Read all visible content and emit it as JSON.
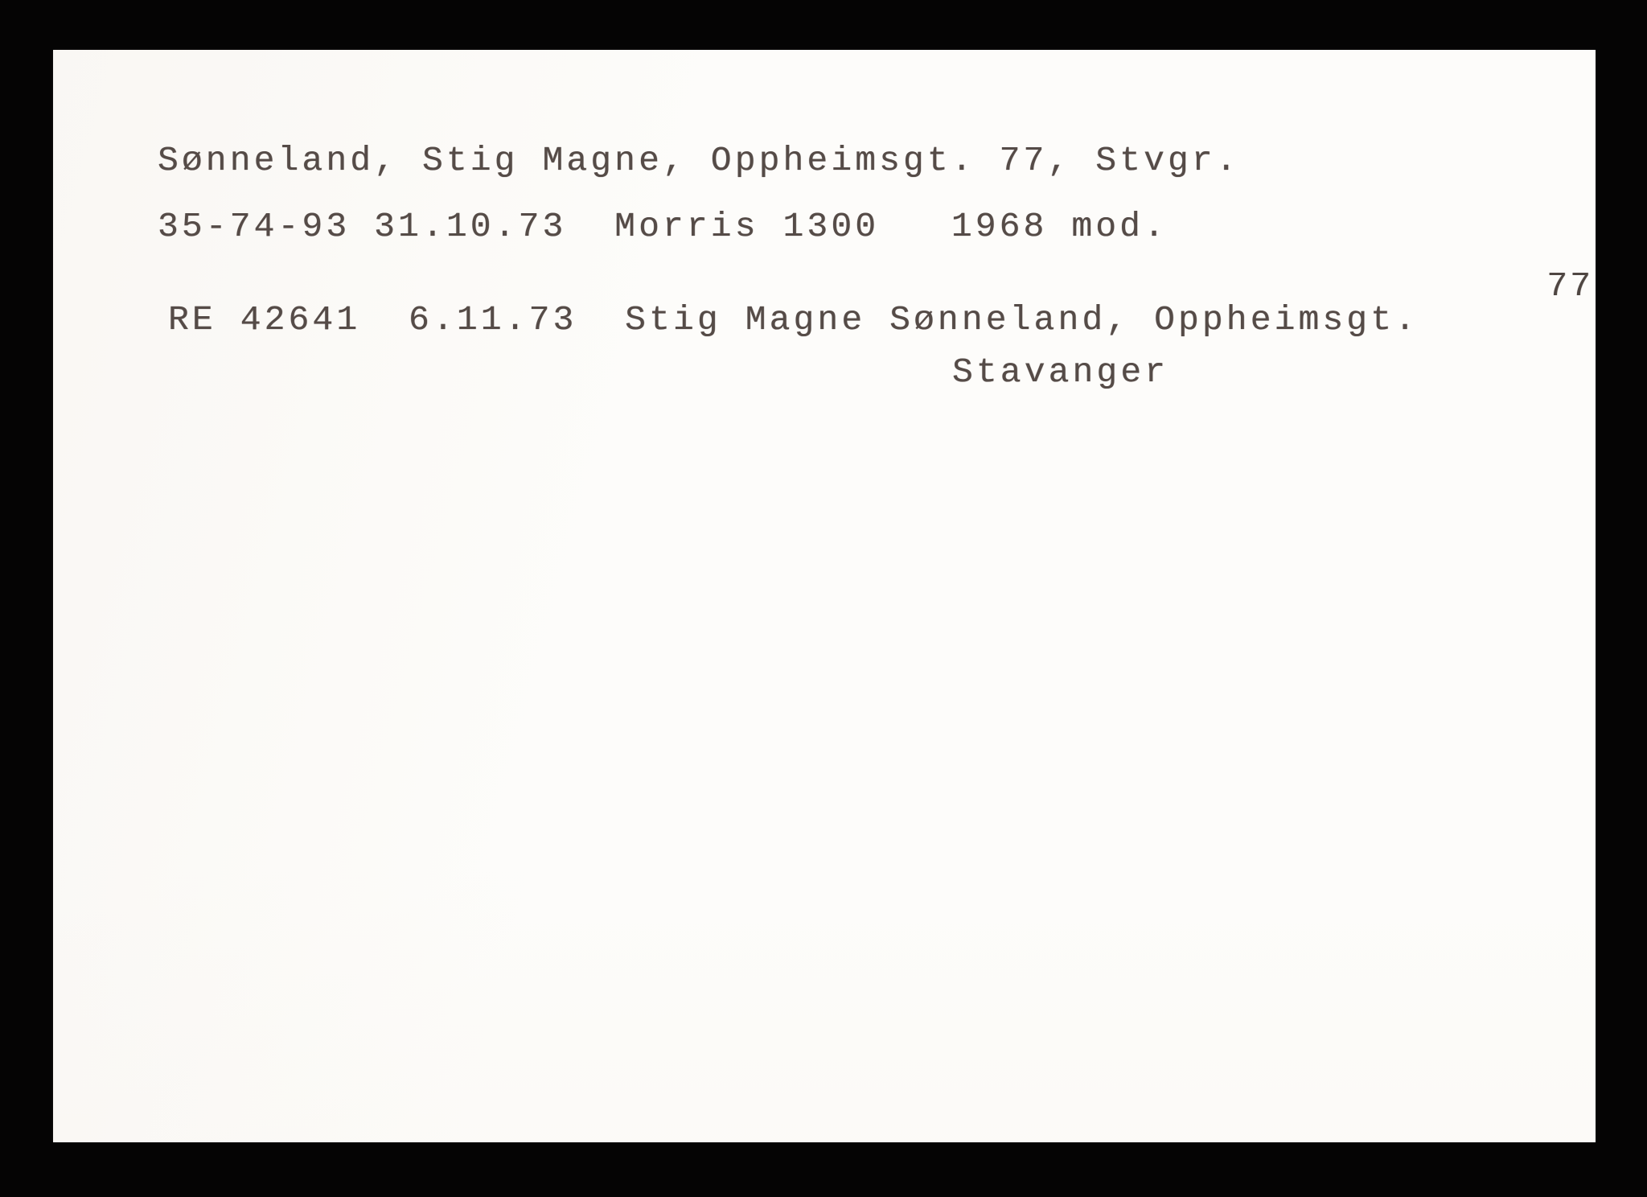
{
  "card": {
    "background_color": "#fdfcfa",
    "backdrop_color": "#050404",
    "ink_color": "#554b47",
    "card_number": "77",
    "lines": {
      "owner": "Sønneland, Stig Magne, Oppheimsgt. 77, Stvgr.",
      "registration": "35-74-93 31.10.73  Morris 1300   1968 mod.",
      "transfer": "RE 42641  6.11.73  Stig Magne Sønneland, Oppheimsgt.",
      "city": "Stavanger"
    },
    "fields": {
      "surname": "Sønneland",
      "given_names": "Stig Magne",
      "street_address": "Oppheimsgt. 77",
      "city_abbreviation": "Stvgr.",
      "plate_number": "35-74-93",
      "registration_date": "31.10.73",
      "vehicle_make": "Morris",
      "vehicle_model": "1300",
      "model_year": "1968 mod.",
      "transfer_plate": "RE 42641",
      "transfer_date": "6.11.73",
      "transfer_owner": "Stig Magne Sønneland",
      "transfer_street": "Oppheimsgt.",
      "transfer_city": "Stavanger"
    }
  }
}
